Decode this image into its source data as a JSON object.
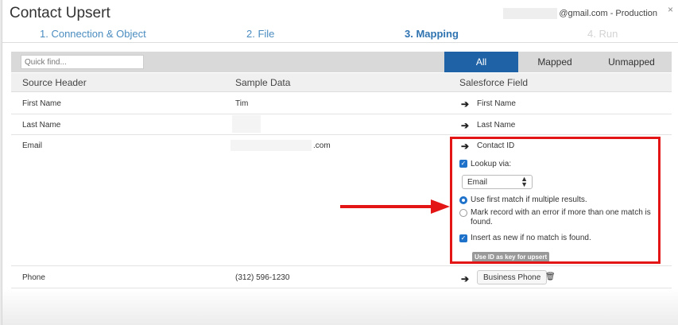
{
  "window": {
    "title": "Contact Upsert",
    "account_suffix": "@gmail.com - Production",
    "close": "×"
  },
  "steps": [
    {
      "label": "1. Connection & Object",
      "state": "done"
    },
    {
      "label": "2. File",
      "state": "done"
    },
    {
      "label": "3. Mapping",
      "state": "active"
    },
    {
      "label": "4. Run",
      "state": "disabled"
    }
  ],
  "toolbar": {
    "search_placeholder": "Quick find...",
    "tabs": [
      "All",
      "Mapped",
      "Unmapped"
    ],
    "active_tab": "All"
  },
  "columns": {
    "source": "Source Header",
    "sample": "Sample Data",
    "salesforce": "Salesforce Field"
  },
  "rows": [
    {
      "source": "First Name",
      "sample": "Tim",
      "field": "First Name"
    },
    {
      "source": "Last Name",
      "sample": "",
      "field": "Last Name"
    },
    {
      "source": "Email",
      "sample": ".com",
      "field": "Contact ID",
      "lookup_label": "Lookup via:",
      "lookup_value": "Email",
      "option_first_match": "Use first match if multiple results.",
      "option_error_match": "Mark record with an error if more than one match is found.",
      "insert_new_label": "Insert as new if no match is found.",
      "upsert_badge": "Use ID as key for upsert"
    },
    {
      "source": "Phone",
      "sample": "(312) 596-1230",
      "field": "Business Phone"
    }
  ],
  "glyphs": {
    "arrow": "➔",
    "check": "✓",
    "trash": "🗑"
  },
  "colors": {
    "accent": "#1f62a6",
    "highlight": "#e31515",
    "checkbox": "#1f72c9"
  }
}
